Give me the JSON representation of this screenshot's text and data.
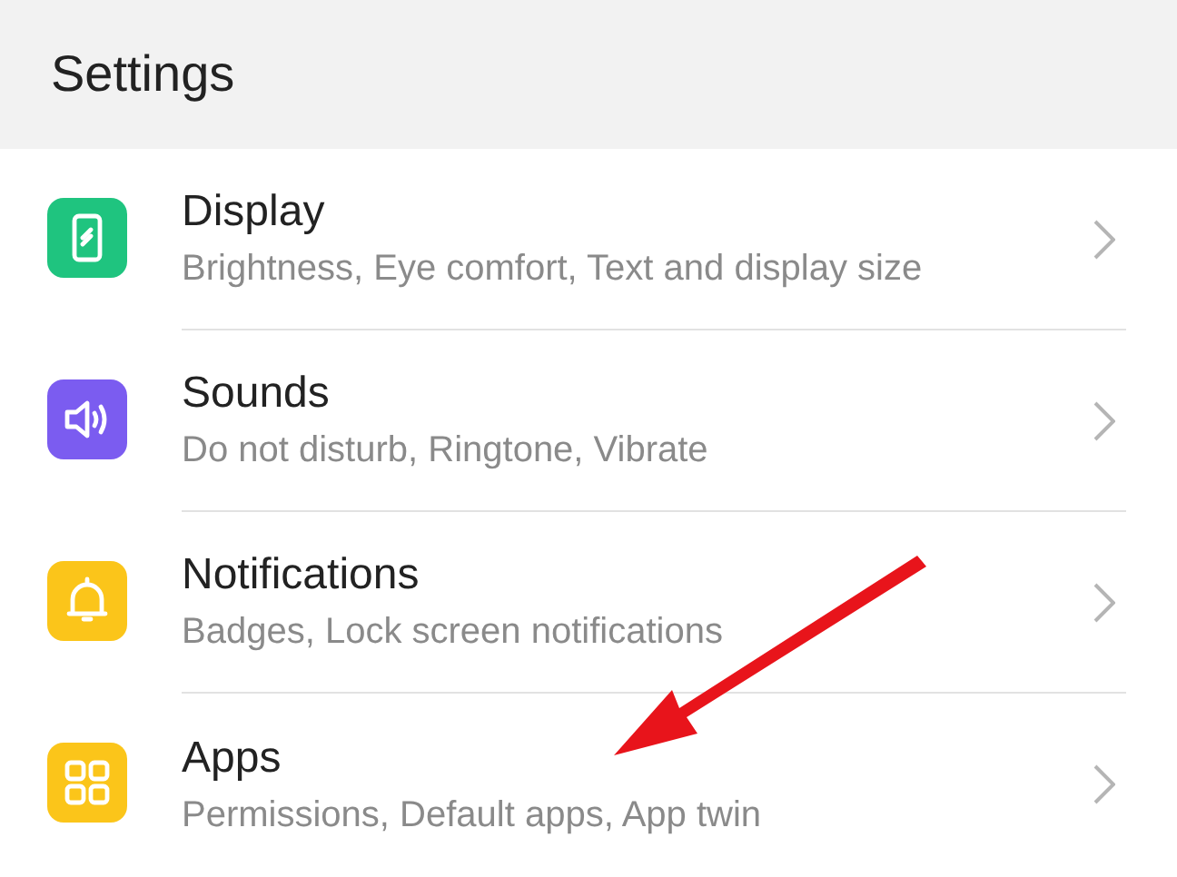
{
  "header": {
    "title": "Settings"
  },
  "items": [
    {
      "kind": "phone",
      "color": "#1fc47f",
      "title": "Display",
      "subtitle": "Brightness, Eye comfort, Text and display size"
    },
    {
      "kind": "speaker",
      "color": "#7b5cf0",
      "title": "Sounds",
      "subtitle": "Do not disturb, Ringtone, Vibrate"
    },
    {
      "kind": "bell",
      "color": "#fbc51a",
      "title": "Notifications",
      "subtitle": "Badges, Lock screen notifications"
    },
    {
      "kind": "grid",
      "color": "#fbc51a",
      "title": "Apps",
      "subtitle": "Permissions, Default apps, App twin"
    }
  ]
}
